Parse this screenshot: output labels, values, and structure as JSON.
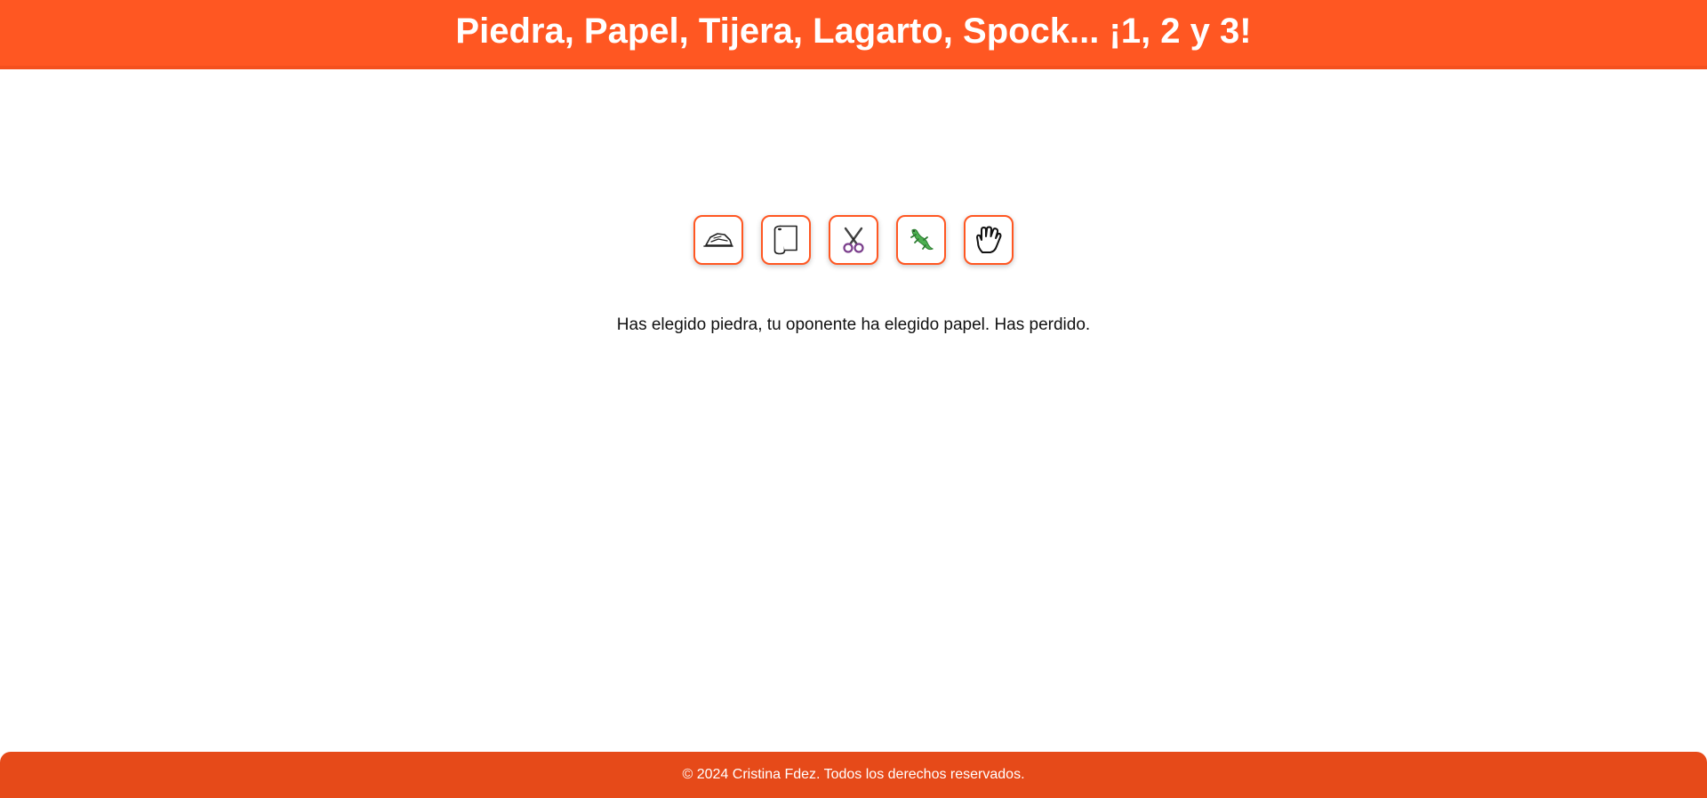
{
  "header": {
    "title": "Piedra, Papel, Tijera, Lagarto, Spock... ¡1, 2 y 3!"
  },
  "choices": [
    {
      "name": "piedra",
      "icon": "rock-icon"
    },
    {
      "name": "papel",
      "icon": "paper-roll-icon"
    },
    {
      "name": "tijera",
      "icon": "scissors-icon"
    },
    {
      "name": "lagarto",
      "icon": "lizard-icon"
    },
    {
      "name": "spock",
      "icon": "vulcan-hand-icon"
    }
  ],
  "result": {
    "text": "Has elegido piedra, tu oponente ha elegido papel. Has perdido."
  },
  "footer": {
    "copyright": "© 2024 Cristina Fdez. Todos los derechos reservados."
  },
  "colors": {
    "header_bg": "#ff5722",
    "footer_bg": "#e64a19",
    "button_border": "#ff5722",
    "lizard": "#4caf50"
  }
}
